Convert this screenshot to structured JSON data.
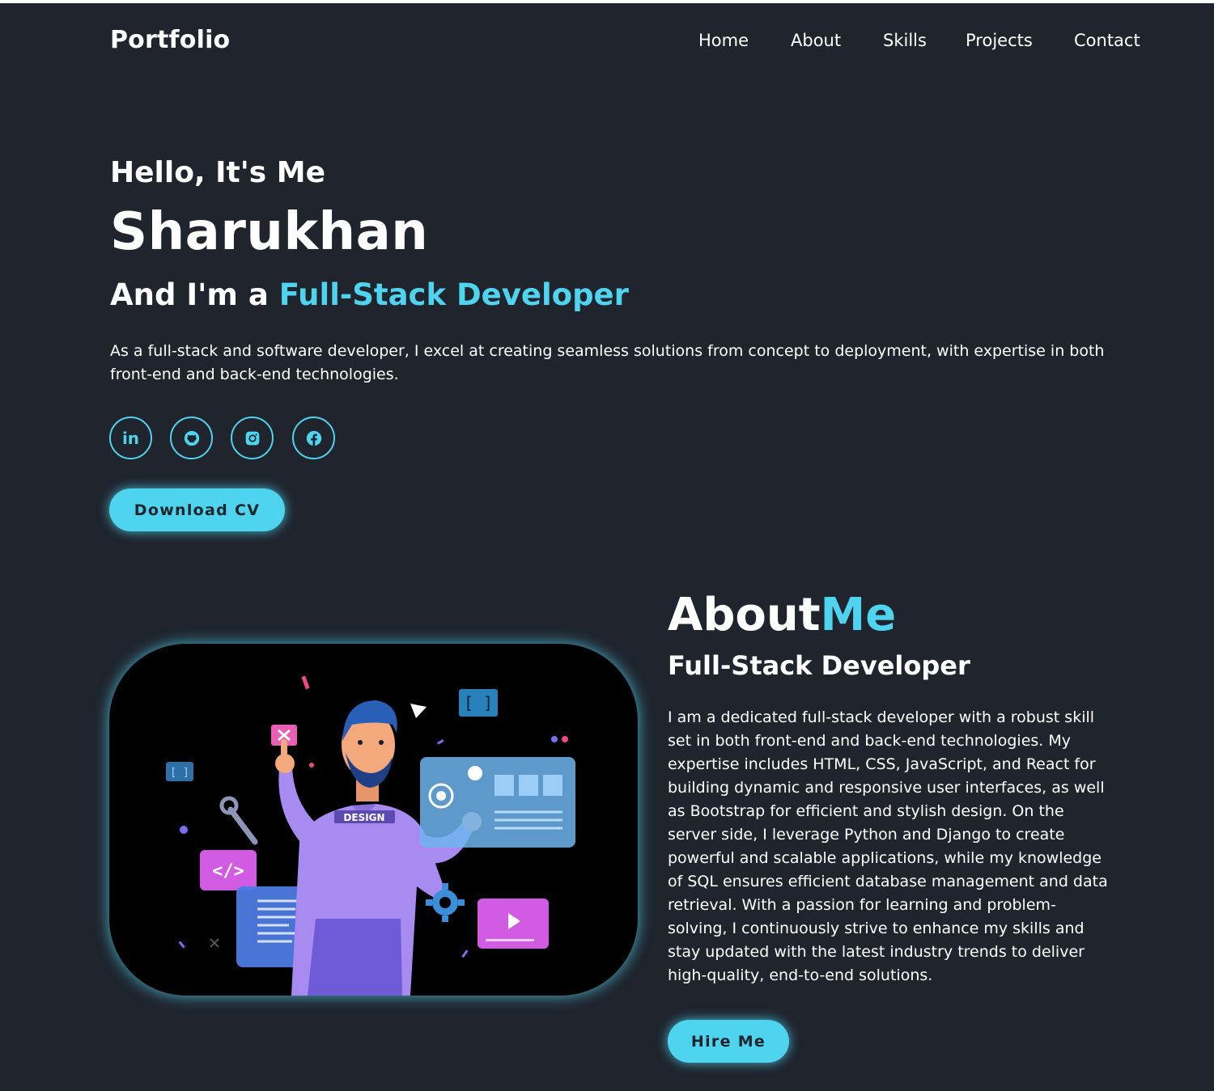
{
  "header": {
    "logo": "Portfolio",
    "nav": [
      "Home",
      "About",
      "Skills",
      "Projects",
      "Contact"
    ]
  },
  "hero": {
    "greeting": "Hello, It's Me",
    "name": "Sharukhan",
    "role_prefix": "And I'm a ",
    "role_highlight": "Full-Stack Developer",
    "description": "As a full-stack and software developer, I excel at creating seamless solutions from concept to deployment, with expertise in both front-end and back-end technologies.",
    "socials": [
      {
        "icon": "linkedin-icon",
        "glyph": "in"
      },
      {
        "icon": "github-icon"
      },
      {
        "icon": "instagram-icon"
      },
      {
        "icon": "facebook-icon"
      }
    ],
    "cta": "Download CV"
  },
  "about": {
    "title_main": "About",
    "title_highlight": "Me",
    "subtitle": "Full-Stack Developer",
    "description": "I am a dedicated full-stack developer with a robust skill set in both front-end and back-end technologies. My expertise includes HTML, CSS, JavaScript, and React for building dynamic and responsive user interfaces, as well as Bootstrap for efficient and stylish design. On the server side, I leverage Python and Django to create powerful and scalable applications, while my knowledge of SQL ensures efficient database management and data retrieval. With a passion for learning and problem-solving, I continuously strive to enhance my skills and stay updated with the latest industry trends to deliver high-quality, end-to-end solutions.",
    "illustration_badge": "DESIGN",
    "illustration_code": "</>",
    "cta": "Hire Me"
  },
  "colors": {
    "background": "#1f242d",
    "accent": "#4fd4ef",
    "text": "#ffffff"
  }
}
